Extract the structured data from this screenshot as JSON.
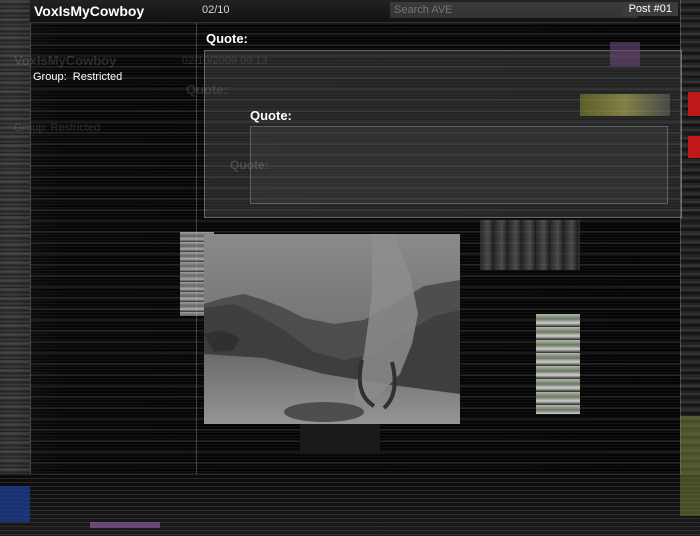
{
  "post": {
    "username": "VoxIsMyCowboy",
    "datetime": "02/10",
    "post_number": "Post #01",
    "group_label": "Group:",
    "group_value": "Restricted"
  },
  "search": {
    "placeholder": "Search AVE"
  },
  "ghost": {
    "username": "VoxIsMyCowboy",
    "datetime": "02/10/2009 09:13",
    "group": "Group: Restricted",
    "quote_a": "Quote:",
    "quote_b": "Quote:"
  },
  "quotes": {
    "outer_label": "Quote:",
    "inner_label": "Quote:"
  },
  "colors": {
    "background": "#050505",
    "header": "#111111",
    "post_badge": "#3c3c3c",
    "quote_box": "#6e6e6e"
  }
}
